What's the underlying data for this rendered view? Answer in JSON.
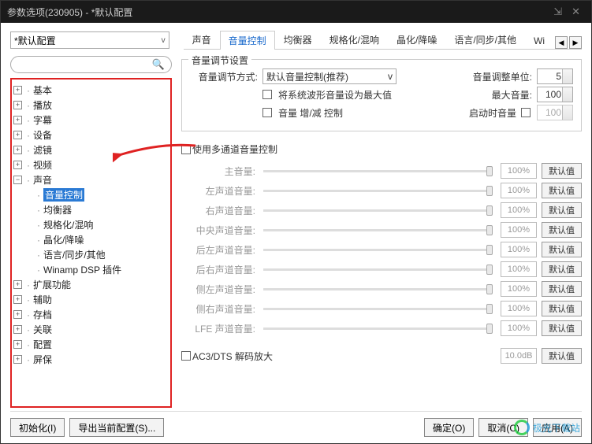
{
  "title": "参数选项(230905) - *默认配置",
  "config_dropdown": "*默认配置",
  "search_placeholder": "",
  "tabs": [
    "声音",
    "音量控制",
    "均衡器",
    "规格化/混响",
    "晶化/降噪",
    "语言/同步/其他",
    "Wi"
  ],
  "tabs_active_index": 1,
  "tree": [
    {
      "label": "基本",
      "type": "parent"
    },
    {
      "label": "播放",
      "type": "parent"
    },
    {
      "label": "字幕",
      "type": "parent"
    },
    {
      "label": "设备",
      "type": "parent"
    },
    {
      "label": "滤镜",
      "type": "parent"
    },
    {
      "label": "视频",
      "type": "parent"
    },
    {
      "label": "声音",
      "type": "parent-open"
    },
    {
      "label": "音量控制",
      "type": "child",
      "selected": true
    },
    {
      "label": "均衡器",
      "type": "child"
    },
    {
      "label": "规格化/混响",
      "type": "child"
    },
    {
      "label": "晶化/降噪",
      "type": "child"
    },
    {
      "label": "语言/同步/其他",
      "type": "child"
    },
    {
      "label": "Winamp DSP 插件",
      "type": "child"
    },
    {
      "label": "扩展功能",
      "type": "parent"
    },
    {
      "label": "辅助",
      "type": "parent"
    },
    {
      "label": "存档",
      "type": "parent"
    },
    {
      "label": "关联",
      "type": "parent"
    },
    {
      "label": "配置",
      "type": "parent"
    },
    {
      "label": "屏保",
      "type": "parent"
    }
  ],
  "group": {
    "title": "音量调节设置",
    "method_label": "音量调节方式:",
    "method_value": "默认音量控制(推荐)",
    "unit_label": "音量调整单位:",
    "unit_value": "5",
    "sys_max_label": "将系统波形音量设为最大值",
    "max_vol_label": "最大音量:",
    "max_vol_value": "100",
    "gain_ctrl_label": "音量 增/减 控制",
    "start_vol_label": "启动时音量",
    "start_vol_value": "100"
  },
  "multichannel_label": "使用多通道音量控制",
  "channels": [
    {
      "label": "主音量:",
      "value": "100%"
    },
    {
      "label": "左声道音量:",
      "value": "100%"
    },
    {
      "label": "右声道音量:",
      "value": "100%"
    },
    {
      "label": "中央声道音量:",
      "value": "100%"
    },
    {
      "label": "后左声道音量:",
      "value": "100%"
    },
    {
      "label": "后右声道音量:",
      "value": "100%"
    },
    {
      "label": "侧左声道音量:",
      "value": "100%"
    },
    {
      "label": "侧右声道音量:",
      "value": "100%"
    },
    {
      "label": "LFE 声道音量:",
      "value": "100%"
    }
  ],
  "default_btn": "默认值",
  "ac3_label": "AC3/DTS 解码放大",
  "ac3_value": "10.0dB",
  "footer": {
    "init": "初始化(I)",
    "export": "导出当前配置(S)...",
    "ok": "确定(O)",
    "cancel": "取消(C)",
    "apply": "应用(A)"
  },
  "watermark": "极光下载站"
}
